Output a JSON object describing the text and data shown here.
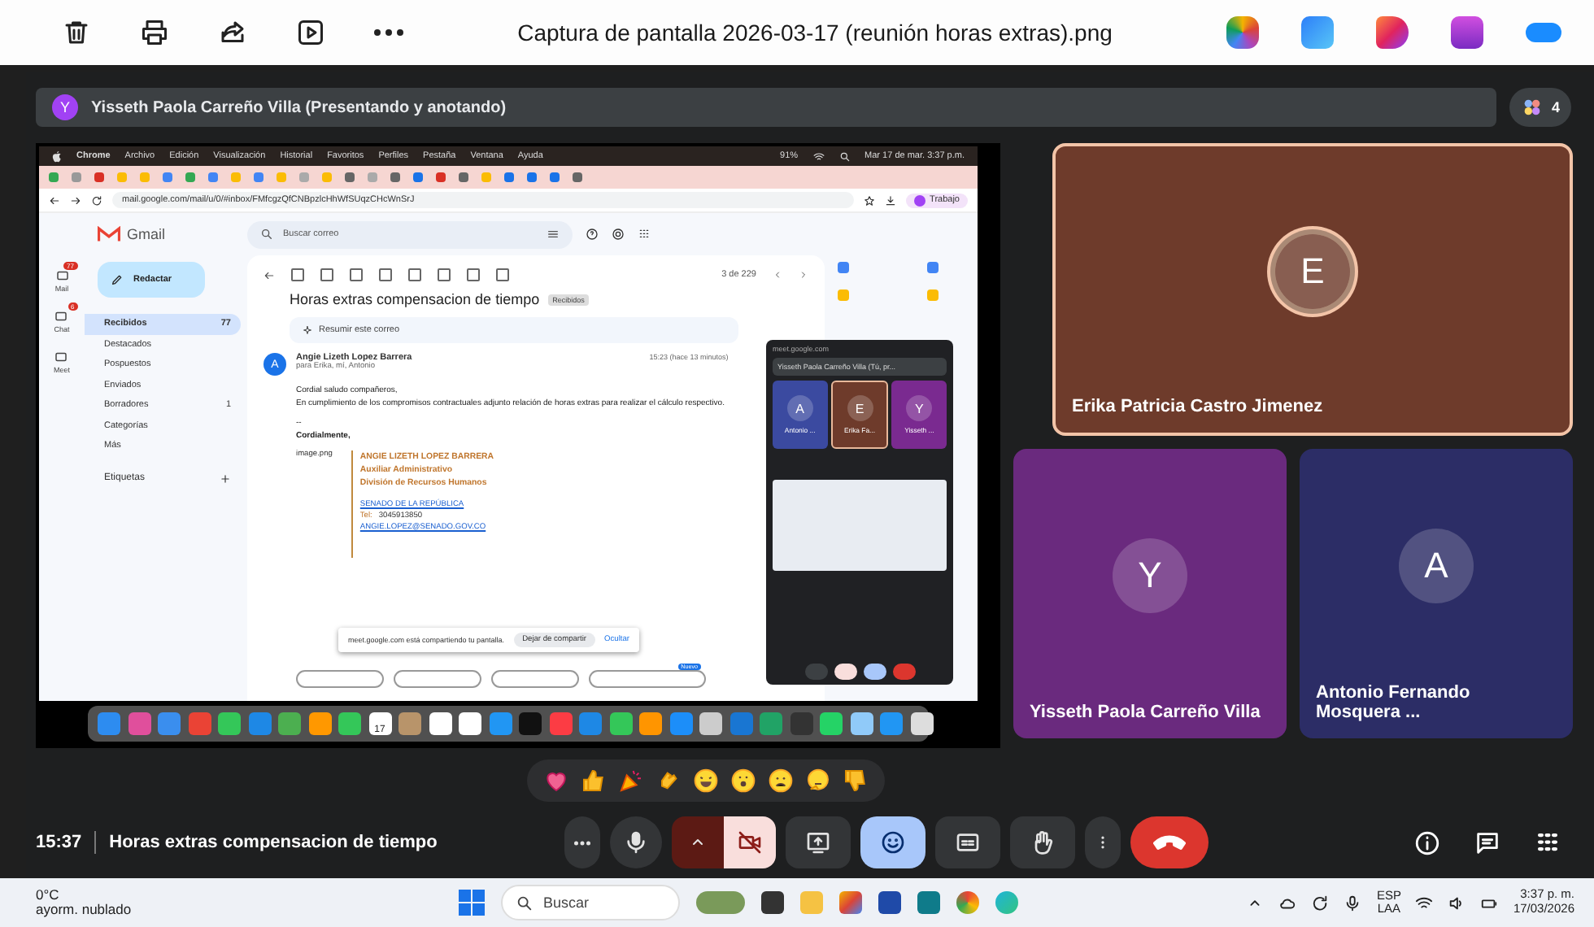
{
  "viewer": {
    "title": "Captura de pantalla 2026-03-17 (reunión horas extras).png"
  },
  "presenter_bar": {
    "avatar": "Y",
    "text": "Yisseth Paola Carreño Villa (Presentando y anotando)",
    "participants": "4"
  },
  "shared_screen": {
    "menu_bar": {
      "app": "Chrome",
      "items": [
        "Archivo",
        "Edición",
        "Visualización",
        "Historial",
        "Favoritos",
        "Perfiles",
        "Pestaña",
        "Ventana",
        "Ayuda"
      ],
      "battery": "91%",
      "clock": "Mar 17 de mar.  3:37 p.m."
    },
    "address": "mail.google.com/mail/u/0/#inbox/FMfcgzQfCNBpzlcHhWfSUqzCHcWnSrJ",
    "profile": "Trabajo",
    "gmail": {
      "logo": "Gmail",
      "search_placeholder": "Buscar correo",
      "compose": "Redactar",
      "rail": [
        {
          "label": "Mail",
          "badge": "77"
        },
        {
          "label": "Chat",
          "badge": "6"
        },
        {
          "label": "Meet"
        }
      ],
      "nav": [
        {
          "label": "Recibidos",
          "count": "77",
          "selected": true
        },
        {
          "label": "Destacados",
          "selected": false
        },
        {
          "label": "Pospuestos",
          "selected": false
        },
        {
          "label": "Enviados",
          "selected": false
        },
        {
          "label": "Borradores",
          "count": "1",
          "selected": false
        },
        {
          "label": "Categorías",
          "selected": false
        },
        {
          "label": "Más",
          "selected": false
        }
      ],
      "labels_heading": "Etiquetas",
      "pager": "3 de 229",
      "subject": "Horas extras compensacion de tiempo",
      "subject_tag": "Recibidos",
      "summarize": "Resumir este correo",
      "sender_avatar": "A",
      "sender": "Angie Lizeth Lopez Barrera",
      "recipients": "para Erika, mí, Antonio",
      "time": "15:23 (hace 13 minutos)",
      "body": [
        "Cordial saludo compañeros,",
        "En cumplimiento de los compromisos contractuales adjunto relación de horas extras para realizar el cálculo respectivo."
      ],
      "separator": "--",
      "closing": "Cordialmente,",
      "signature": {
        "image_alt": "image.png",
        "name": "ANGIE LIZETH LOPEZ BARRERA",
        "role": "Auxiliar Administrativo",
        "division": "División de Recursos Humanos",
        "org": "SENADO DE LA REPÚBLICA",
        "tel_label": "Tel:",
        "tel": "3045913850",
        "email": "ANGIE.LOPEZ@SENADO.GOV.CO"
      },
      "new_badge": "Nuevo"
    },
    "share_notice": {
      "text": "meet.google.com está compartiendo tu pantalla.",
      "stop": "Dejar de compartir",
      "hide": "Ocultar"
    },
    "mini_meet": {
      "url": "meet.google.com",
      "presenter": "Yisseth Paola Carreño Villa (Tú, pr...",
      "tiles": [
        {
          "letter": "A",
          "name": "Antonio ...",
          "color": "#3b4aa0",
          "speaking": false
        },
        {
          "letter": "E",
          "name": "Erika Fa...",
          "color": "#6e3b2b",
          "speaking": true
        },
        {
          "letter": "Y",
          "name": "Yisseth ...",
          "color": "#7a2a90",
          "speaking": false
        }
      ]
    },
    "dock_date": "17"
  },
  "tiles": [
    {
      "letter": "E",
      "name": "Erika Patricia Castro Jimenez",
      "color": "#6e3b2b",
      "speaking": true
    },
    {
      "letter": "Y",
      "name": "Yisseth Paola Carreño Villa",
      "color": "#6a2a7e",
      "speaking": false
    },
    {
      "letter": "A",
      "name": "Antonio Fernando Mosquera ...",
      "color": "#2c2d66",
      "speaking": false
    }
  ],
  "meeting": {
    "time": "15:37",
    "title": "Horas extras compensacion de tiempo"
  },
  "controls": [
    {
      "kind": "more",
      "active": false
    },
    {
      "kind": "mic",
      "active": false
    },
    {
      "kind": "caret",
      "active": false
    },
    {
      "kind": "camera",
      "active": false
    },
    {
      "kind": "present",
      "active": false
    },
    {
      "kind": "reactions",
      "active": true
    },
    {
      "kind": "captions",
      "active": false
    },
    {
      "kind": "hand",
      "active": false
    },
    {
      "kind": "options",
      "active": false
    },
    {
      "kind": "end",
      "active": false
    }
  ],
  "taskbar": {
    "temp": "0°C",
    "weather": "ayorm. nublado",
    "search": "Buscar",
    "lang": "ESP",
    "layout": "LAA",
    "time": "3:37 p. m.",
    "date": "17/03/2026"
  }
}
